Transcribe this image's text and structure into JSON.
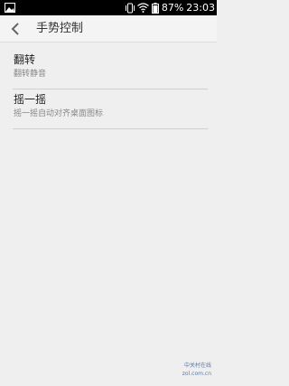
{
  "status_bar": {
    "battery_percent": "87%",
    "time": "23:03",
    "icons": [
      "image-icon",
      "vibrate-icon",
      "wifi-icon",
      "battery-icon"
    ]
  },
  "app_bar": {
    "title": "手势控制",
    "back_icon": "chevron-left-icon"
  },
  "settings": [
    {
      "title": "翻转",
      "subtitle": "翻转静音"
    },
    {
      "title": "摇一摇",
      "subtitle": "摇一摇自动对齐桌面图标"
    }
  ],
  "watermark": {
    "line1": "中关村在线",
    "line2": "zol.com.cn"
  },
  "colors": {
    "background": "#efefef",
    "status_bar": "#000000",
    "divider": "#cfcfcf",
    "subtitle": "#888888"
  }
}
